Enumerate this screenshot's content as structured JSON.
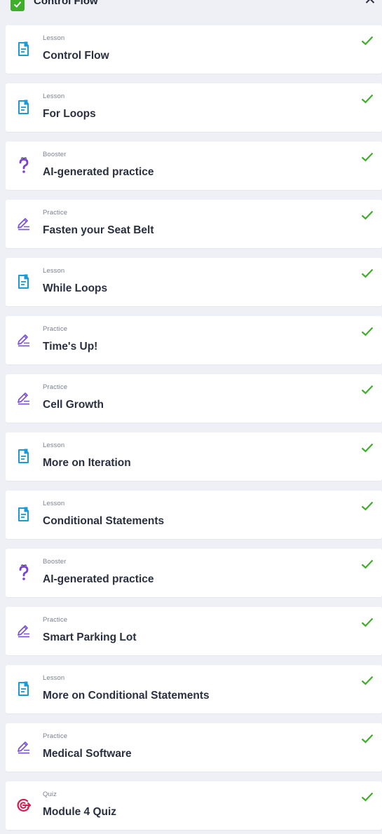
{
  "module": {
    "title": "Control Flow",
    "check_color": "#3fae2a",
    "collapse_icon": "chevron-up-icon"
  },
  "colors": {
    "lesson": "#1a9ad6",
    "booster": "#7b3fd4",
    "practice": "#7b52d6",
    "quiz": "#d9184f",
    "done": "#3fae2a"
  },
  "items": [
    {
      "kind": "Lesson",
      "title": "Control Flow",
      "icon": "lesson-document-icon",
      "completed": true
    },
    {
      "kind": "Lesson",
      "title": "For Loops",
      "icon": "lesson-document-icon",
      "completed": true
    },
    {
      "kind": "Booster",
      "title": "AI-generated practice",
      "icon": "question-mark-icon",
      "completed": true
    },
    {
      "kind": "Practice",
      "title": "Fasten your Seat Belt",
      "icon": "pencil-icon",
      "completed": true
    },
    {
      "kind": "Lesson",
      "title": "While Loops",
      "icon": "lesson-document-icon",
      "completed": true
    },
    {
      "kind": "Practice",
      "title": "Time's Up!",
      "icon": "pencil-icon",
      "completed": true
    },
    {
      "kind": "Practice",
      "title": "Cell Growth",
      "icon": "pencil-icon",
      "completed": true
    },
    {
      "kind": "Lesson",
      "title": "More on Iteration",
      "icon": "lesson-document-icon",
      "completed": true
    },
    {
      "kind": "Lesson",
      "title": "Conditional Statements",
      "icon": "lesson-document-icon",
      "completed": true
    },
    {
      "kind": "Booster",
      "title": "AI-generated practice",
      "icon": "question-mark-icon",
      "completed": true
    },
    {
      "kind": "Practice",
      "title": "Smart Parking Lot",
      "icon": "pencil-icon",
      "completed": true
    },
    {
      "kind": "Lesson",
      "title": "More on Conditional Statements",
      "icon": "lesson-document-icon",
      "completed": true
    },
    {
      "kind": "Practice",
      "title": "Medical Software",
      "icon": "pencil-icon",
      "completed": true
    },
    {
      "kind": "Quiz",
      "title": "Module 4 Quiz",
      "icon": "target-icon",
      "completed": true
    }
  ]
}
